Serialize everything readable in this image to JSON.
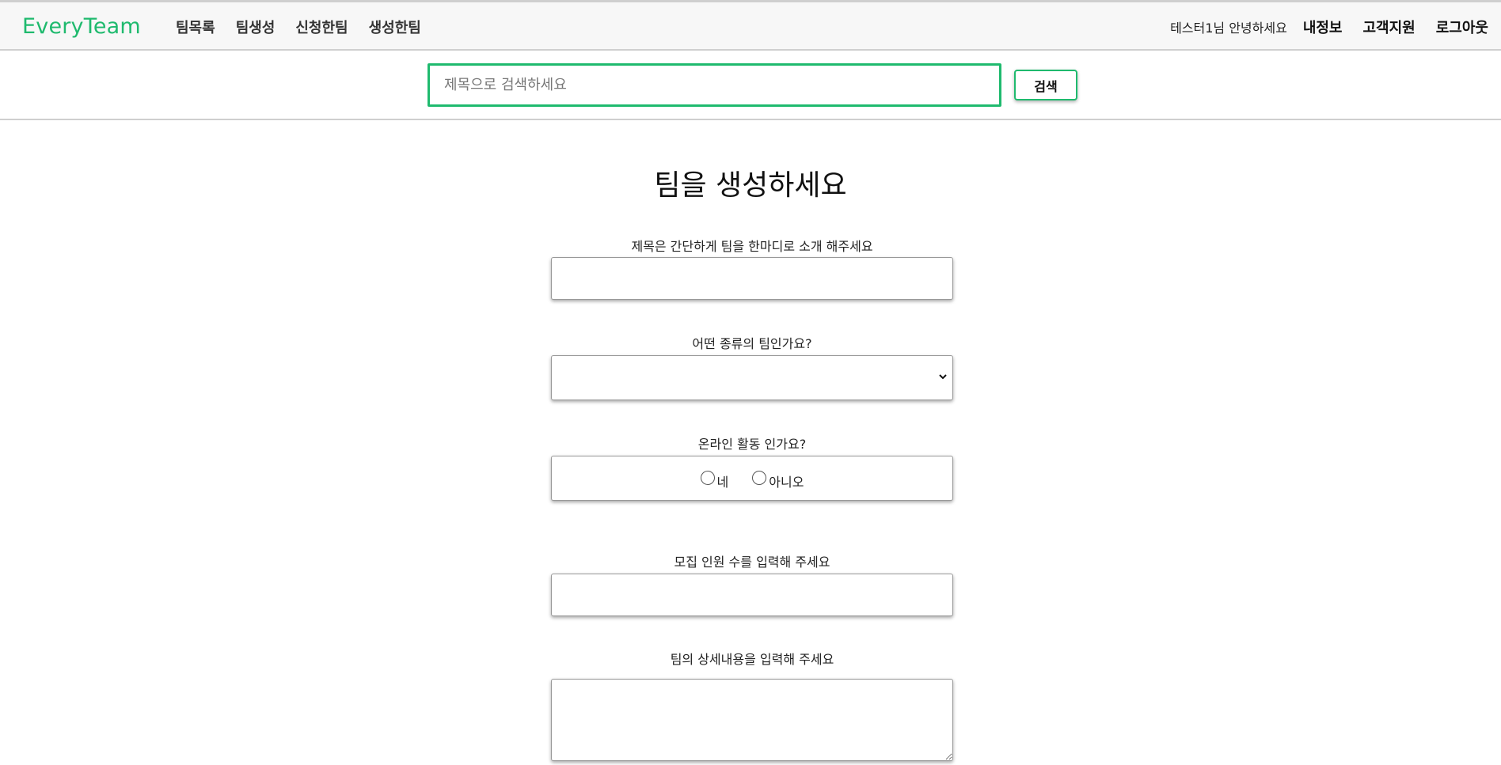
{
  "navbar": {
    "logo": "EveryTeam",
    "links": [
      "팀목록",
      "팀생성",
      "신청한팀",
      "생성한팀"
    ],
    "greeting": "테스터1님 안녕하세요",
    "right_links": [
      "내정보",
      "고객지원",
      "로그아웃"
    ]
  },
  "search": {
    "placeholder": "제목으로 검색하세요",
    "value": "",
    "button_label": "검색"
  },
  "form": {
    "title": "팀을 생성하세요",
    "title_field": {
      "label": "제목은 간단하게 팀을 한마디로 소개 해주세요",
      "value": ""
    },
    "type_field": {
      "label": "어떤 종류의 팀인가요?",
      "selected": ""
    },
    "online_field": {
      "label": "온라인 활동 인가요?",
      "options": [
        "네",
        "아니오"
      ]
    },
    "members_field": {
      "label": "모집 인원 수를 입력해 주세요",
      "value": ""
    },
    "detail_field": {
      "label": "팀의 상세내용을 입력해 주세요",
      "value": ""
    }
  },
  "colors": {
    "accent": "#1fba6e",
    "nav_bg": "#f7f7f7",
    "border": "#cfcfcf"
  }
}
